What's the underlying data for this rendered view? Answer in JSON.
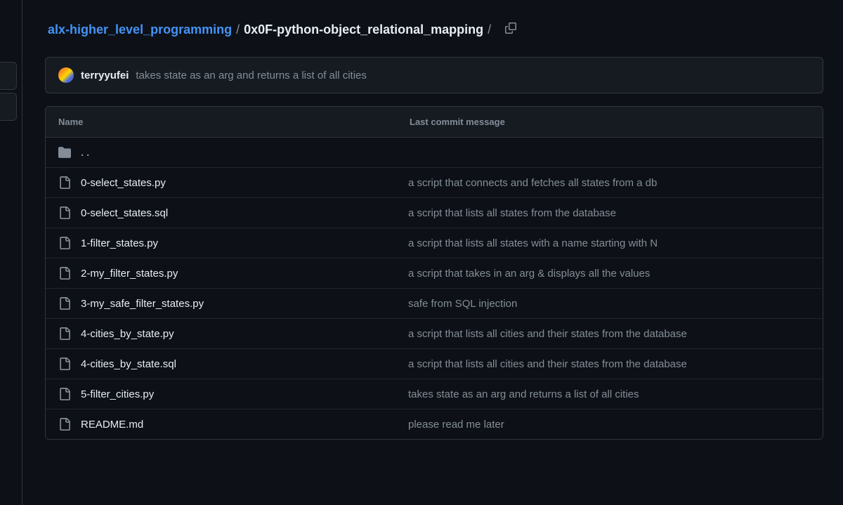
{
  "breadcrumb": {
    "repo": "alx-higher_level_programming",
    "current": "0x0F-python-object_relational_mapping",
    "sep": "/",
    "trailing": "/"
  },
  "latest_commit": {
    "author": "terryyufei",
    "message": "takes state as an arg and returns a list of all cities"
  },
  "table_headers": {
    "name": "Name",
    "message": "Last commit message"
  },
  "parent_dir": "..",
  "files": [
    {
      "name": "0-select_states.py",
      "message": "a script that connects and fetches all states from a db"
    },
    {
      "name": "0-select_states.sql",
      "message": "a script that lists all states from the database"
    },
    {
      "name": "1-filter_states.py",
      "message": "a script that lists all states with a name starting with N"
    },
    {
      "name": "2-my_filter_states.py",
      "message": "a script that takes in an arg & displays all the values"
    },
    {
      "name": "3-my_safe_filter_states.py",
      "message": "safe from SQL injection"
    },
    {
      "name": "4-cities_by_state.py",
      "message": "a script that lists all cities and their states from the database"
    },
    {
      "name": "4-cities_by_state.sql",
      "message": "a script that lists all cities and their states from the database"
    },
    {
      "name": "5-filter_cities.py",
      "message": "takes state as an arg and returns a list of all cities"
    },
    {
      "name": "README.md",
      "message": "please read me later"
    }
  ]
}
